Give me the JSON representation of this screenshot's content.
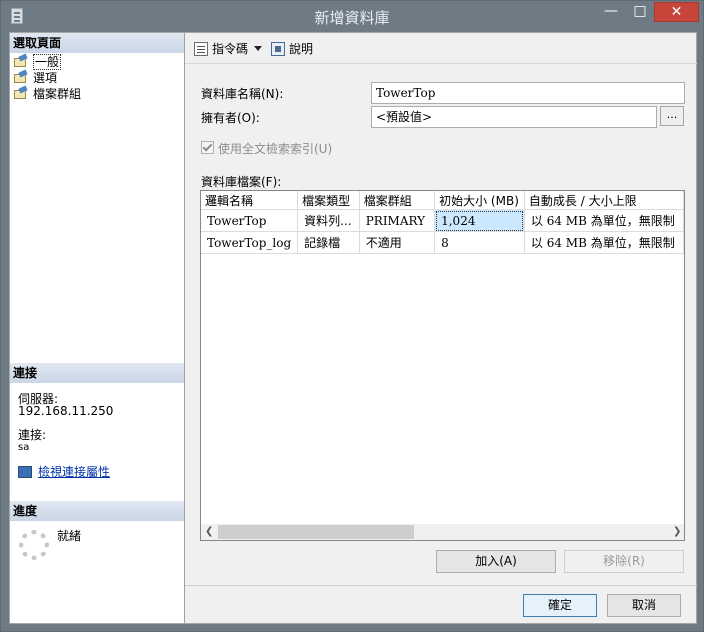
{
  "window": {
    "title": "新增資料庫"
  },
  "sidebar": {
    "select_page_header": "選取頁面",
    "pages": [
      {
        "label": "一般",
        "icon": "page-icon",
        "selected": true
      },
      {
        "label": "選項",
        "icon": "page-icon",
        "selected": false
      },
      {
        "label": "檔案群組",
        "icon": "page-icon",
        "selected": false
      }
    ],
    "connection_header": "連接",
    "server_label": "伺服器:",
    "server_value": "192.168.11.250",
    "connection_label": "連接:",
    "connection_value": "sa",
    "view_props_link": "檢視連接屬性",
    "progress_header": "進度",
    "progress_status": "就緒"
  },
  "toolbar": {
    "script_label": "指令碼",
    "help_label": "說明"
  },
  "form": {
    "db_name_label": "資料庫名稱(N):",
    "db_name_value": "TowerTop",
    "owner_label": "擁有者(O):",
    "owner_value": "<預設值>",
    "owner_browse": "...",
    "fulltext_label": "使用全文檢索索引(U)",
    "fulltext_checked": true,
    "files_label": "資料庫檔案(F):"
  },
  "grid": {
    "columns": [
      "邏輯名稱",
      "檔案類型",
      "檔案群組",
      "初始大小 (MB)",
      "自動成長 / 大小上限"
    ],
    "rows": [
      [
        "TowerTop",
        "資料列...",
        "PRIMARY",
        "1,024",
        "以 64 MB 為單位，無限制"
      ],
      [
        "TowerTop_log",
        "記錄檔",
        "不適用",
        "8",
        "以 64 MB 為單位，無限制"
      ]
    ]
  },
  "buttons": {
    "add": "加入(A)",
    "remove": "移除(R)",
    "ok": "確定",
    "cancel": "取消"
  },
  "colors": {
    "titlebar": "#6f7b84",
    "close": "#c7463c",
    "selected_cell": "#cce8ff",
    "section_header": "#c9d6e6"
  }
}
